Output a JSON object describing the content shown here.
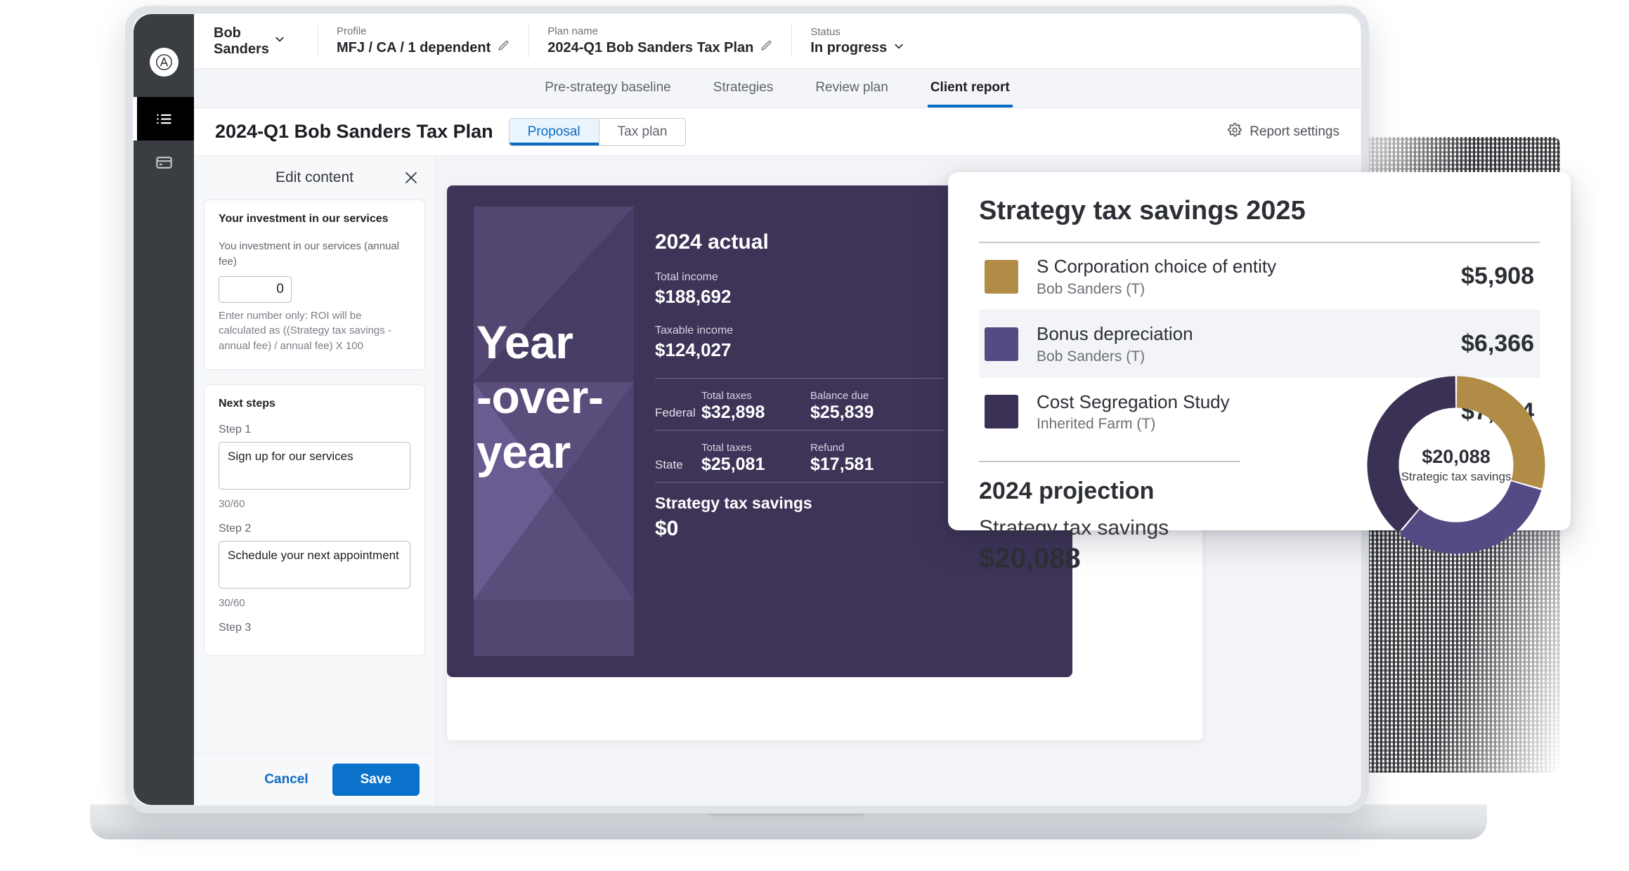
{
  "header": {
    "client_name_line1": "Bob",
    "client_name_line2": "Sanders",
    "profile_label": "Profile",
    "profile_value": "MFJ / CA / 1 dependent",
    "plan_name_label": "Plan name",
    "plan_name_value": "2024-Q1 Bob Sanders Tax Plan",
    "status_label": "Status",
    "status_value": "In progress"
  },
  "tabs": [
    {
      "label": "Pre-strategy baseline",
      "active": false
    },
    {
      "label": "Strategies",
      "active": false
    },
    {
      "label": "Review plan",
      "active": false
    },
    {
      "label": "Client report",
      "active": true
    }
  ],
  "subheader": {
    "plan_title": "2024-Q1 Bob Sanders Tax Plan",
    "segment": [
      {
        "label": "Proposal",
        "active": true
      },
      {
        "label": "Tax plan",
        "active": false
      }
    ],
    "report_settings_label": "Report settings"
  },
  "edit_panel": {
    "title": "Edit content",
    "investment_card": {
      "title": "Your investment in our services",
      "field_label": "You investment in our services (annual fee)",
      "field_value": "0",
      "help_text": "Enter number only: ROI will be calculated as ((Strategy tax savings - annual fee) / annual fee) X 100"
    },
    "next_steps_card": {
      "title": "Next steps",
      "steps": [
        {
          "label": "Step 1",
          "value": "Sign up for our services",
          "count": "30/60"
        },
        {
          "label": "Step 2",
          "value": "Schedule your next appointment",
          "count": "30/60"
        },
        {
          "label": "Step 3",
          "value": "",
          "count": ""
        }
      ]
    },
    "cancel_label": "Cancel",
    "save_label": "Save"
  },
  "report": {
    "hero_text": "Year -over- year",
    "section_title": "2024 actual",
    "total_income_label": "Total income",
    "total_income_value": "$188,692",
    "taxable_income_label": "Taxable income",
    "taxable_income_value": "$124,027",
    "tax_rows": [
      {
        "jurisdiction": "Federal",
        "col1_label": "Total taxes",
        "col1_value": "$32,898",
        "col2_label": "Balance due",
        "col2_value": "$25,839"
      },
      {
        "jurisdiction": "State",
        "col1_label": "Total taxes",
        "col1_value": "$25,081",
        "col2_label": "Refund",
        "col2_value": "$17,581"
      }
    ],
    "savings_label": "Strategy tax savings",
    "savings_value": "$0"
  },
  "savings_card": {
    "title": "Strategy tax savings 2025",
    "rows": [
      {
        "name": "S Corporation choice of entity",
        "owner": "Bob Sanders (T)",
        "amount": "$5,908",
        "color": "#b08c46",
        "highlighted": false
      },
      {
        "name": "Bonus depreciation",
        "owner": "Bob Sanders (T)",
        "amount": "$6,366",
        "color": "#564a85",
        "highlighted": true
      },
      {
        "name": "Cost Segregation Study",
        "owner": "Inherited Farm (T)",
        "amount": "$7,814",
        "color": "#3a3154",
        "highlighted": false
      }
    ],
    "projection_title": "2024 projection",
    "projection_sub": "Strategy tax savings",
    "projection_value": "$20,088",
    "donut_center_value": "$20,088",
    "donut_center_label": "Strategic tax savings"
  },
  "chart_data": {
    "type": "pie",
    "title": "Strategy tax savings 2025",
    "categories": [
      "S Corporation choice of entity",
      "Bonus depreciation",
      "Cost Segregation Study"
    ],
    "values": [
      5908,
      6366,
      7814
    ],
    "colors": [
      "#b08c46",
      "#564a85",
      "#3a3154"
    ],
    "total": 20088,
    "center_value": "$20,088",
    "center_label": "Strategic tax savings",
    "legend_position": "left",
    "donut": true,
    "start_angle_deg": 0
  },
  "colors": {
    "accent_blue": "#0b72cc",
    "purple_card": "#3e3458",
    "rail_dark": "#3a3d42",
    "gold": "#b08c46",
    "mid_purple": "#564a85",
    "dark_purple": "#3a3154"
  },
  "icons": {
    "logo": "brand-logo-icon",
    "list": "list-icon",
    "card": "card-icon",
    "pencil": "pencil-icon",
    "chevron": "chevron-down-icon",
    "gear": "gear-icon",
    "close": "close-icon"
  }
}
